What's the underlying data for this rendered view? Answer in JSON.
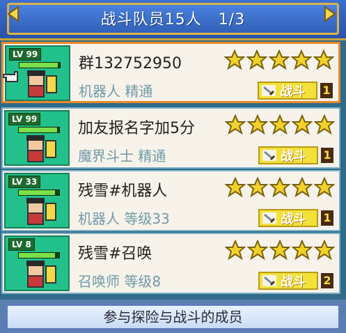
{
  "header": {
    "title": "战斗队员15人",
    "page": "1/3"
  },
  "members": [
    {
      "level_label": "LV",
      "level": "99",
      "hp": 0.95,
      "name": "群132752950",
      "job": "机器人 精通",
      "stars": 5,
      "badge": "战斗",
      "count": "1",
      "selected": true
    },
    {
      "level_label": "LV",
      "level": "99",
      "hp": 0.95,
      "name": "加友报名字加5分",
      "job": "魔界斗士 精通",
      "stars": 5,
      "badge": "战斗",
      "count": "1",
      "selected": false
    },
    {
      "level_label": "LV",
      "level": "33",
      "hp": 0.9,
      "name": "残雪#机器人",
      "job": "机器人 等级33",
      "stars": 5,
      "badge": "战斗",
      "count": "1",
      "selected": false
    },
    {
      "level_label": "LV",
      "level": "8",
      "hp": 0.9,
      "name": "残雪#召唤",
      "job": "召唤师 等级8",
      "stars": 5,
      "badge": "战斗",
      "count": "2",
      "selected": false
    }
  ],
  "footer": {
    "label": "参与探险与战斗的成员"
  },
  "colors": {
    "star": "#f1d12a",
    "selected_border": "#e98a2a",
    "badge": "#f3e13a"
  },
  "icons": [
    "arrow-left-icon",
    "arrow-right-icon",
    "star-icon",
    "sword-icon",
    "pointer-hand-icon"
  ]
}
